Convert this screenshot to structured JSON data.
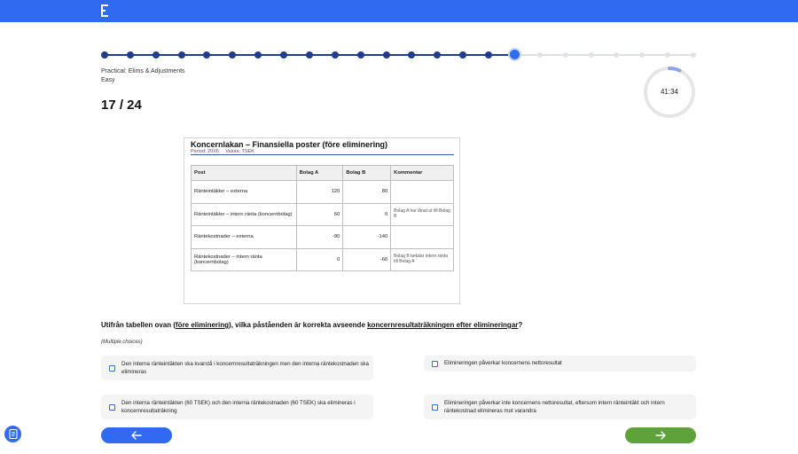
{
  "progress": {
    "total": 24,
    "current": 17
  },
  "meta": {
    "category": "Practical: Elims & Adjustments",
    "difficulty": "Easy"
  },
  "counter": "17 / 24",
  "timer": {
    "text": "41:34",
    "fraction_elapsed": 0.07
  },
  "document": {
    "title": "Koncernlakan – Finansiella poster (före eliminering)",
    "period": "Period: 20X6",
    "currency": "Valuta: TSEK",
    "headers": [
      "Post",
      "Bolag A",
      "Bolag B",
      "Kommentar"
    ],
    "rows": [
      {
        "post": "Ränteintäkter – externa",
        "a": "120",
        "b": "80",
        "kommentar": ""
      },
      {
        "post": "Ränteintäkter – intern ränta (koncernbolag)",
        "a": "60",
        "b": "0",
        "kommentar": "Bolag A har lånat ut till Bolag B"
      },
      {
        "post": "Räntekostnader – externa",
        "a": "-90",
        "b": "-140",
        "kommentar": ""
      },
      {
        "post": "Räntekostnader – intern ränta (koncernbolag)",
        "a": "0",
        "b": "-60",
        "kommentar": "Bolag B betalar intern ränta till Bolag A"
      }
    ]
  },
  "question": {
    "part1": "Utifrån tabellen ovan (",
    "link1": "före eliminering",
    "part2": "), vilka påståenden är korrekta avseende ",
    "link2": "koncernresultaträkningen efter elimineringar",
    "part3": "?",
    "hint": "(Multiple choices)"
  },
  "options": [
    "Den interna ränteintäkten ska kvarstå i koncernresultaträkningen men den interna räntekostnaden ska elimineras",
    "Elimineringen påverkar koncernens nettoresultat",
    "Den interna ränteintäkten (60 TSEK) och den interna räntekostnaden (60 TSEK) ska elimineras i koncernresultaträkning",
    "Elimineringen påverkar inte koncernens nettoresultat, eftersom intern ränteintäkt och intern räntekostnad elimineras mot varandra"
  ],
  "nav": {
    "back_icon": "arrow-left-icon",
    "next_icon": "arrow-right-icon",
    "notes_icon": "notes-icon"
  },
  "colors": {
    "brand": "#2f6af0",
    "done": "#1f3d8a",
    "next": "#5ea33a"
  }
}
